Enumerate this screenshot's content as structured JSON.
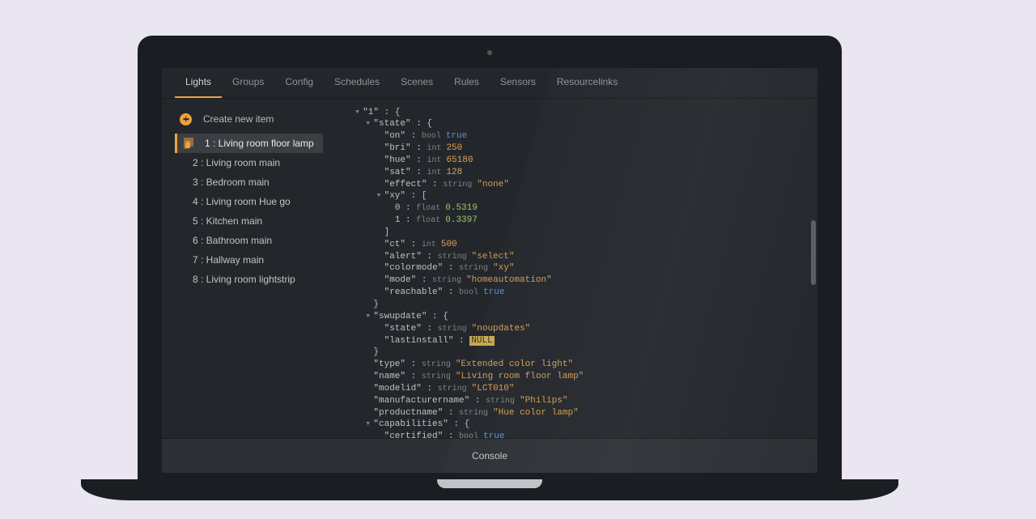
{
  "tabs": {
    "items": [
      "Lights",
      "Groups",
      "Config",
      "Schedules",
      "Scenes",
      "Rules",
      "Sensors",
      "Resourcelinks"
    ],
    "active": 0
  },
  "sidebar": {
    "create_label": "Create new item",
    "items": [
      {
        "id": "1",
        "label": "1 : Living room floor lamp",
        "selected": true
      },
      {
        "id": "2",
        "label": "2 : Living room main",
        "selected": false
      },
      {
        "id": "3",
        "label": "3 : Bedroom main",
        "selected": false
      },
      {
        "id": "4",
        "label": "4 : Living room Hue go",
        "selected": false
      },
      {
        "id": "5",
        "label": "5 : Kitchen main",
        "selected": false
      },
      {
        "id": "6",
        "label": "6 : Bathroom main",
        "selected": false
      },
      {
        "id": "7",
        "label": "7 : Hallway main",
        "selected": false
      },
      {
        "id": "8",
        "label": "8 : Living room lightstrip",
        "selected": false
      }
    ]
  },
  "json": {
    "lines": [
      {
        "indent": 0,
        "arrow": true,
        "key": "1",
        "after": " : {"
      },
      {
        "indent": 1,
        "arrow": true,
        "key": "state",
        "after": " : {"
      },
      {
        "indent": 2,
        "arrow": false,
        "key": "on",
        "colon": true,
        "type": "bool",
        "value": "true"
      },
      {
        "indent": 2,
        "arrow": false,
        "key": "bri",
        "colon": true,
        "type": "int",
        "value": "250"
      },
      {
        "indent": 2,
        "arrow": false,
        "key": "hue",
        "colon": true,
        "type": "int",
        "value": "65180"
      },
      {
        "indent": 2,
        "arrow": false,
        "key": "sat",
        "colon": true,
        "type": "int",
        "value": "128"
      },
      {
        "indent": 2,
        "arrow": false,
        "key": "effect",
        "colon": true,
        "type": "string",
        "value": "\"none\""
      },
      {
        "indent": 2,
        "arrow": true,
        "key": "xy",
        "after": " : ["
      },
      {
        "indent": 3,
        "arrow": false,
        "rawkey": "0",
        "colon": true,
        "type": "float",
        "value": "0.5319"
      },
      {
        "indent": 3,
        "arrow": false,
        "rawkey": "1",
        "colon": true,
        "type": "float",
        "value": "0.3397"
      },
      {
        "indent": 2,
        "arrow": false,
        "closer": "]"
      },
      {
        "indent": 2,
        "arrow": false,
        "key": "ct",
        "colon": true,
        "type": "int",
        "value": "500"
      },
      {
        "indent": 2,
        "arrow": false,
        "key": "alert",
        "colon": true,
        "type": "string",
        "value": "\"select\""
      },
      {
        "indent": 2,
        "arrow": false,
        "key": "colormode",
        "colon": true,
        "type": "string",
        "value": "\"xy\""
      },
      {
        "indent": 2,
        "arrow": false,
        "key": "mode",
        "colon": true,
        "type": "string",
        "value": "\"homeautomation\""
      },
      {
        "indent": 2,
        "arrow": false,
        "key": "reachable",
        "colon": true,
        "type": "bool",
        "value": "true"
      },
      {
        "indent": 1,
        "arrow": false,
        "closer": "}"
      },
      {
        "indent": 1,
        "arrow": true,
        "key": "swupdate",
        "after": " : {"
      },
      {
        "indent": 2,
        "arrow": false,
        "key": "state",
        "colon": true,
        "type": "string",
        "value": "\"noupdates\""
      },
      {
        "indent": 2,
        "arrow": false,
        "key": "lastinstall",
        "colon": true,
        "null": true,
        "value": "NULL"
      },
      {
        "indent": 1,
        "arrow": false,
        "closer": "}"
      },
      {
        "indent": 1,
        "arrow": false,
        "key": "type",
        "colon": true,
        "type": "string",
        "value": "\"Extended color light\""
      },
      {
        "indent": 1,
        "arrow": false,
        "key": "name",
        "colon": true,
        "type": "string",
        "value": "\"Living room floor lamp\""
      },
      {
        "indent": 1,
        "arrow": false,
        "key": "modelid",
        "colon": true,
        "type": "string",
        "value": "\"LCT010\""
      },
      {
        "indent": 1,
        "arrow": false,
        "key": "manufacturername",
        "colon": true,
        "type": "string",
        "value": "\"Philips\""
      },
      {
        "indent": 1,
        "arrow": false,
        "key": "productname",
        "colon": true,
        "type": "string",
        "value": "\"Hue color lamp\""
      },
      {
        "indent": 1,
        "arrow": true,
        "key": "capabilities",
        "after": " : {"
      },
      {
        "indent": 2,
        "arrow": false,
        "key": "certified",
        "colon": true,
        "type": "bool",
        "value": "true"
      }
    ]
  },
  "console": {
    "label": "Console"
  }
}
